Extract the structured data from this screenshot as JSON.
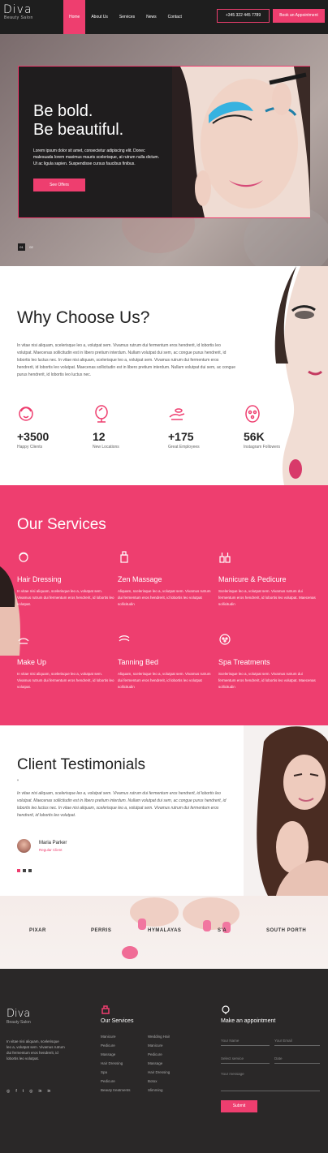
{
  "header": {
    "logo": "Diva",
    "logo_sub": "Beauty Salon",
    "nav": [
      "Home",
      "About Us",
      "Services",
      "News",
      "Contact"
    ],
    "phone": "+345 322 445 7789",
    "book": "Book an Appointment"
  },
  "hero": {
    "title_line1": "Be bold.",
    "title_line2": "Be beautiful.",
    "text": "Lorem ipsum dolor sit amet, consectetur adipiscing elit. Donec malesuada lorem maximus mauris scelerisque, at rutrum nulla dictum. Ut ac ligula sapien. Suspendisse cursus faucibus finibus.",
    "button": "See Offers",
    "slide_1": "01",
    "slide_2": "02"
  },
  "why": {
    "title": "Why Choose Us?",
    "text": "In vitae nisi aliquam, scelerisque leo a, volutpat sem. Vivamus rutrum dui fermentum eros hendrerit, id lobortis leo volutpat. Maecenas sollicitudin est in libero pretium interdum. Nullam volutpat dui sem, ac congue purus hendrerit, id lobortis leo luctus nec. In vitae nisi aliquam, scelerisque leo a, volutpat sem. Vivamus rutrum dui fermentum eros hendrerit, id lobortis leo volutpat. Maecenas sollicitudin est in libero pretium interdum. Nullam volutpat dui sem, ac congue purus hendrerit, id lobortis leo luctus nec.",
    "stats": [
      {
        "num": "+3500",
        "label": "Happy Clients",
        "icon": "face-icon"
      },
      {
        "num": "12",
        "label": "New Locations",
        "icon": "mirror-icon"
      },
      {
        "num": "+175",
        "label": "Great Employees",
        "icon": "hand-icon"
      },
      {
        "num": "56K",
        "label": "Instagram Followers",
        "icon": "mask-icon"
      }
    ]
  },
  "services": {
    "title": "Our Services",
    "items": [
      {
        "title": "Hair Dressing",
        "text": "In vitae nisi aliquam, scelerisque leo a, volutpat sem. Vivamus rutrum dui fermentum eros hendrerit, id lobortis leo volutpat.",
        "icon": "hair-icon"
      },
      {
        "title": "Zen Massage",
        "text": "Aliquam, scelerisque leo a, volutpat sem. Vivamus rutrum dui fermentum eros hendrerit, id lobortis leo volutpat sollicitudin",
        "icon": "oil-bottle-icon"
      },
      {
        "title": "Manicure & Pedicure",
        "text": "Scelerisque leo a, volutpat sem. Vivamus rutrum dui fermentum eros hendrerit, id lobortis leo volutpat. Maecenas sollicitudin",
        "icon": "nail-polish-icon"
      },
      {
        "title": "Make Up",
        "text": "In vitae nisi aliquam, scelerisque leo a, volutpat sem. Vivamus rutrum dui fermentum eros hendrerit, id lobortis leo volutpat.",
        "icon": "makeup-icon"
      },
      {
        "title": "Tanning Bed",
        "text": "Aliquam, scelerisque leo a, volutpat sem. Vivamus rutrum dui fermentum eros hendrerit, id lobortis leo volutpat sollicitudin",
        "icon": "tanning-icon"
      },
      {
        "title": "Spa Treatments",
        "text": "Scelerisque leo a, volutpat sem. Vivamus rutrum dui fermentum eros hendrerit, id lobortis leo volutpat. Maecenas sollicitudin",
        "icon": "spa-icon"
      }
    ]
  },
  "testimonials": {
    "title": "Client Testimonials",
    "quote": "“",
    "text": "In vitae nisi aliquam, scelerisque leo a, volutpat sem. Vivamus rutrum dui fermentum eros hendrerit, id lobortis leo volutpat. Maecenas sollicitudin est in libero pretium interdum. Nullam volutpat dui sem, ac congue purus hendrerit, id lobortis leo luctus nec. In vitae nisi aliquam, scelerisque leo a, volutpat sem. Vivamus rutrum dui fermentum eros hendrerit, id lobortis leo volutpat.",
    "name": "Maria Parker",
    "role": "Regular Client"
  },
  "brands": [
    "PIXAR",
    "PERRIS",
    "HYMALAYAS",
    "S'A",
    "SOUTH PORTH"
  ],
  "footer": {
    "logo": "Diva",
    "logo_sub": "Beauty Salon",
    "text": "In vitae nisi aliquam, scelerisque leo a, volutpat sem. Vivamus rutrum dui fermentum eros hendrerit, id lobortis leo volutpat.",
    "services_title": "Our Services",
    "services_col1": [
      "Manicure",
      "Pedicure",
      "Massage",
      "Hair Dressing",
      "Spa",
      "Pedicure",
      "Beauty treatments"
    ],
    "services_col2": [
      "Wedding Hair",
      "Manicure",
      "Pedicure",
      "Massage",
      "Hair Dressing",
      "Botox",
      "Slimming"
    ],
    "appointment_title": "Make an appointment",
    "placeholders": {
      "name": "Your Name",
      "email": "Your Email",
      "service": "Select service",
      "date": "Date",
      "message": "Your message"
    },
    "submit": "Submit",
    "social": [
      "◎",
      "f",
      "t",
      "◎",
      "in",
      "in"
    ]
  },
  "colors": {
    "accent": "#ee3e6f",
    "dark": "#1e1e1e"
  }
}
